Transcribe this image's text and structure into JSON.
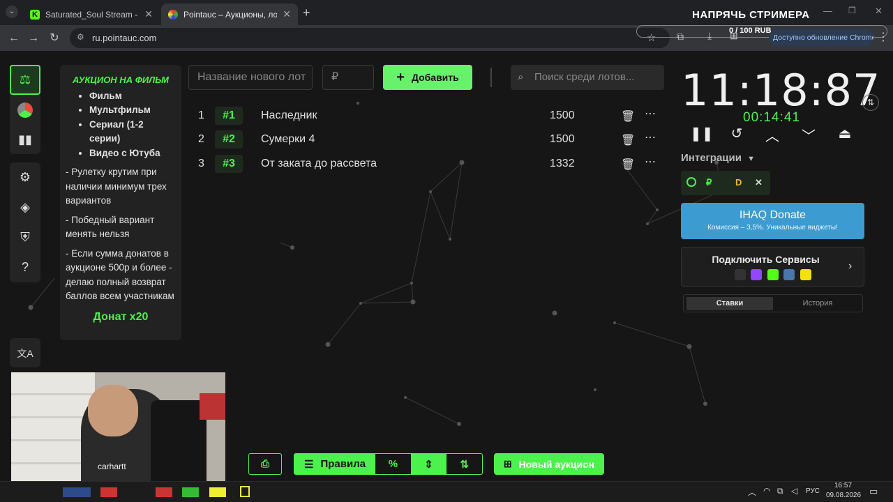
{
  "browser": {
    "tabs": [
      {
        "label": "Saturated_Soul Stream - Watch",
        "active": false
      },
      {
        "label": "Pointauc – Аукционы, лотереи",
        "active": true
      }
    ],
    "url": "ru.pointauc.com",
    "update_label": "Доступно обновление Chrome"
  },
  "overlay": {
    "title": "НАПРЯЧЬ СТРИМЕРА",
    "goal": "0 / 100 RUB"
  },
  "rules": {
    "title": "АУКЦИОН НА ФИЛЬМ",
    "bullets": [
      "Фильм",
      "Мультфильм",
      "Сериал (1-2 серии)",
      "Видео с Ютуба"
    ],
    "p1": "- Рулетку крутим при наличии минимум трех вариантов",
    "p2": "- Победный вариант менять нельзя",
    "p3": "-  Если сумма донатов в аукционе 500р и более - делаю полный возврат баллов всем участникам",
    "donate": "Донат x20"
  },
  "form": {
    "name_placeholder": "Название нового лот",
    "amount_placeholder": "₽",
    "add_label": "Добавить",
    "search_placeholder": "Поиск среди лотов..."
  },
  "lots": [
    {
      "index": "1",
      "tag": "#1",
      "name": "Наследник",
      "amount": "1500"
    },
    {
      "index": "2",
      "tag": "#2",
      "name": "Сумерки 4",
      "amount": "1500"
    },
    {
      "index": "3",
      "tag": "#3",
      "name": "От заката до рассвета",
      "amount": "1332"
    }
  ],
  "timer": {
    "main": "11:18:87",
    "sub": "00:14:41"
  },
  "integrations": {
    "label": "Интеграции",
    "donate_title": "IHAQ Donate",
    "donate_sub": "Комиссия – 3,5%. Уникальные виджеты!",
    "connect_title": "Подключить Сервисы",
    "tabs": [
      "Ставки",
      "История"
    ]
  },
  "bottombar": {
    "rules_label": "Правила",
    "percent_label": "%",
    "new_auction_label": "Новый аукцион"
  },
  "taskbar": {
    "lang": "РУС",
    "time": "16:57",
    "date": "09.08.2026"
  },
  "webcam": {
    "shirt_text": "carhartt"
  },
  "colors": {
    "accent": "#4cf24c",
    "button_green": "#68f26b",
    "donate_blue": "#3c9bd1"
  }
}
